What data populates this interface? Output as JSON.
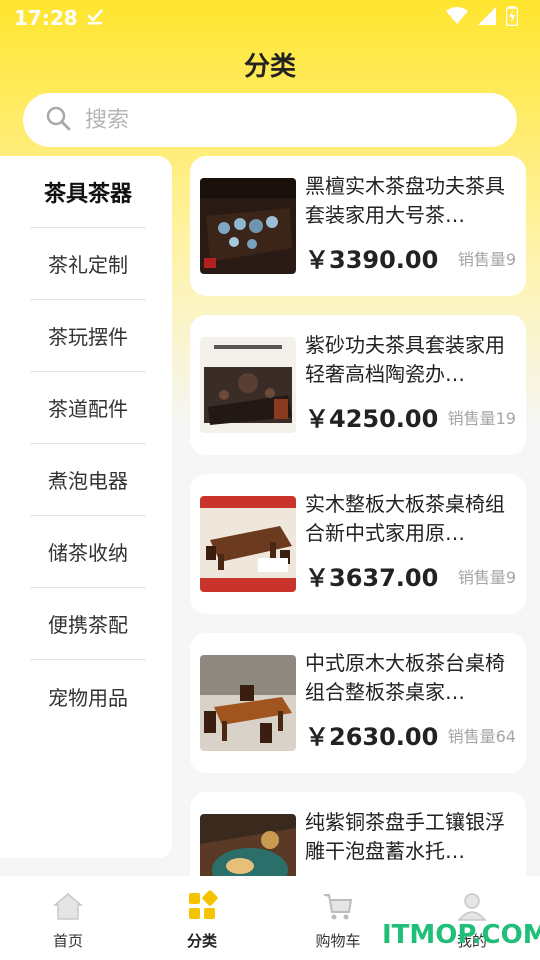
{
  "status_bar": {
    "time": "17:28"
  },
  "header": {
    "title": "分类"
  },
  "search": {
    "placeholder": "搜索"
  },
  "sidebar": {
    "items": [
      {
        "label": "茶具茶器",
        "active": true
      },
      {
        "label": "茶礼定制",
        "active": false
      },
      {
        "label": "茶玩摆件",
        "active": false
      },
      {
        "label": "茶道配件",
        "active": false
      },
      {
        "label": "煮泡电器",
        "active": false
      },
      {
        "label": "储茶收纳",
        "active": false
      },
      {
        "label": "便携茶配",
        "active": false
      },
      {
        "label": "宠物用品",
        "active": false
      }
    ]
  },
  "products": [
    {
      "title": "黑檀实木茶盘功夫茶具套装家用大号茶…",
      "price": "￥3390.00",
      "sales": "销售量9"
    },
    {
      "title": "紫砂功夫茶具套装家用轻奢高档陶瓷办…",
      "price": "￥4250.00",
      "sales": "销售量19"
    },
    {
      "title": "实木整板大板茶桌椅组合新中式家用原…",
      "price": "￥3637.00",
      "sales": "销售量9"
    },
    {
      "title": "中式原木大板茶台桌椅组合整板茶桌家…",
      "price": "￥2630.00",
      "sales": "销售量64"
    },
    {
      "title": "纯紫铜茶盘手工镶银浮雕干泡盘蓄水托…",
      "price": "",
      "sales": ""
    }
  ],
  "tabbar": {
    "items": [
      {
        "label": "首页",
        "icon": "home-icon",
        "active": false
      },
      {
        "label": "分类",
        "icon": "category-icon",
        "active": true
      },
      {
        "label": "购物车",
        "icon": "cart-icon",
        "active": false
      },
      {
        "label": "我的",
        "icon": "profile-icon",
        "active": false
      }
    ]
  },
  "watermark": {
    "text": "ITMOP.COM"
  },
  "colors": {
    "accent": "#FFE52E",
    "active_tab": "#F5C400",
    "watermark": "#1FBF7A"
  }
}
